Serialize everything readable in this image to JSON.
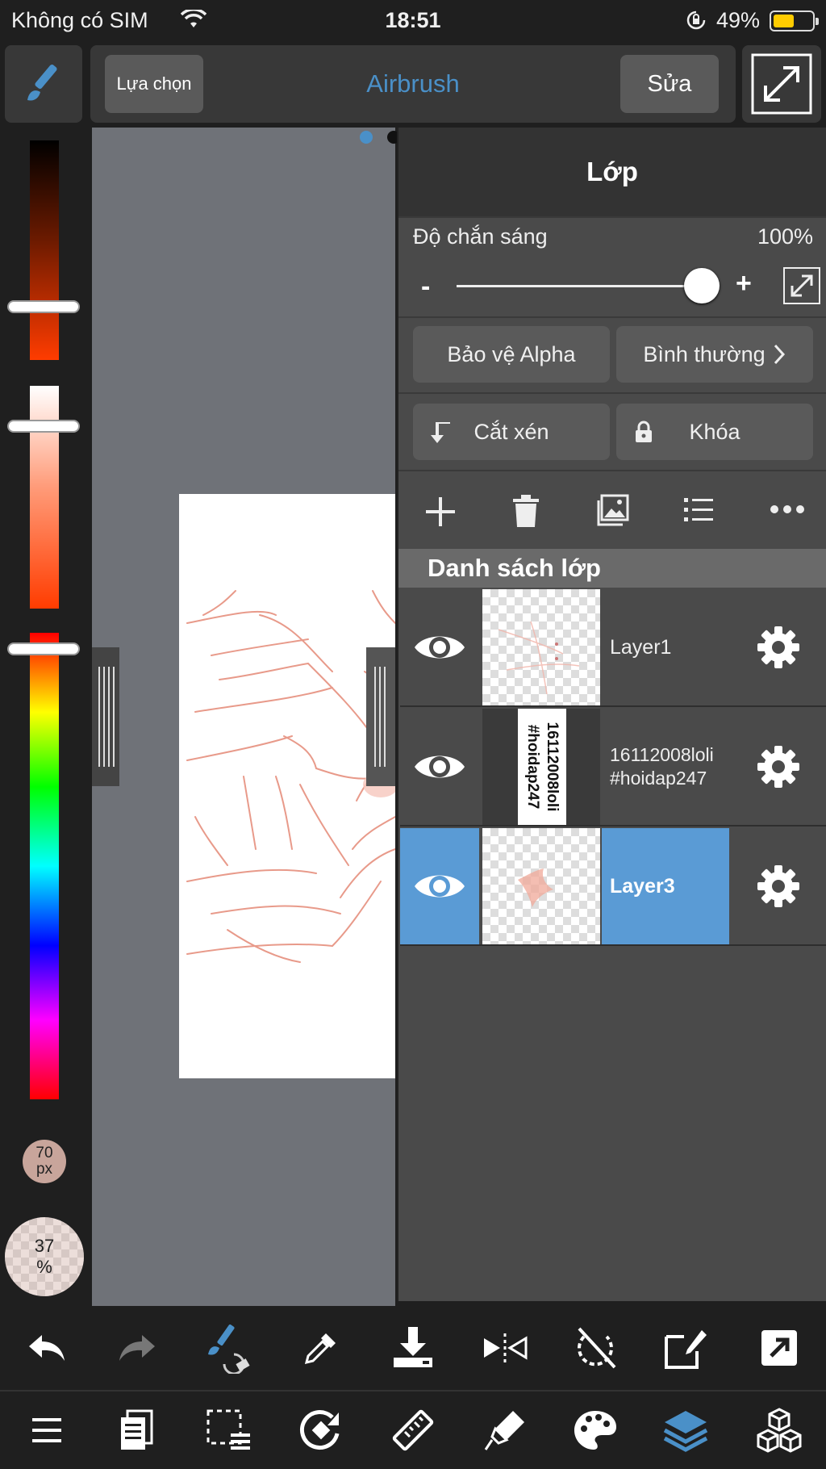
{
  "status_bar": {
    "carrier": "Không có SIM",
    "time": "18:51",
    "battery": "49%",
    "battery_level": 0.49
  },
  "toolbar": {
    "select_label": "Lựa chọn",
    "tool_name": "Airbrush",
    "edit_label": "Sửa"
  },
  "left_panel": {
    "brush_size": "70",
    "brush_size_unit": "px",
    "opacity": "37",
    "opacity_unit": "%"
  },
  "layer_panel": {
    "title": "Lớp",
    "opacity_label": "Độ chắn sáng",
    "opacity_value": "100%",
    "opacity_level": 1.0,
    "minus": "-",
    "plus": "+",
    "alpha_protect": "Bảo vệ Alpha",
    "blend_mode": "Bình thường",
    "clipping": "Cắt xén",
    "lock": "Khóa",
    "list_header": "Danh sách lớp",
    "layers": [
      {
        "name": "Layer1",
        "selected": false
      },
      {
        "name": "16112008loli\n#hoidap247",
        "selected": false,
        "thumb_text_1": "16112008loli",
        "thumb_text_2": "#hoidap247"
      },
      {
        "name": "Layer3",
        "selected": true
      }
    ]
  },
  "colors": {
    "accent": "#4a90c8",
    "selected_layer": "#5a9bd5",
    "panel": "#4a4a4a",
    "button": "#5a5a5a"
  }
}
